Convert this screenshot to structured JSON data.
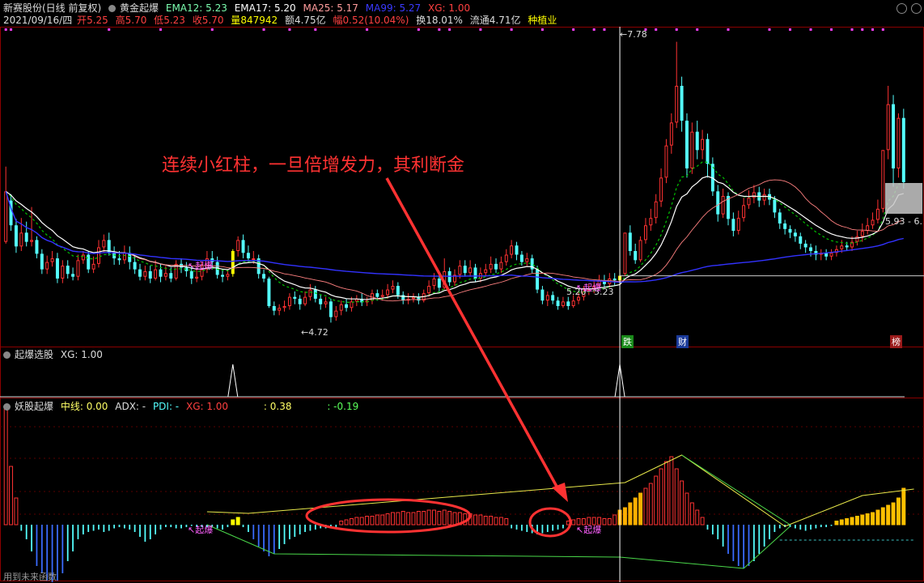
{
  "header": {
    "stock_name": "新赛股份(日线 前复权)",
    "indicator_name": "黄金起爆",
    "ema12": "EMA12: 5.23",
    "ema17": "EMA17: 5.20",
    "ma25": "MA25: 5.17",
    "ma99": "MA99: 5.27",
    "xg": "XG: 1.00"
  },
  "quote": {
    "date": "2021/09/16/四",
    "open_label": "开",
    "open": "5.25",
    "high_label": "高",
    "high": "5.70",
    "low_label": "低",
    "low": "5.23",
    "close_label": "收",
    "close": "5.70",
    "vol_label": "量",
    "vol": "847942",
    "amount": "额4.75亿",
    "change_label": "幅",
    "change": "0.52(10.04%)",
    "turnover": "换18.01%",
    "float": "流通4.71亿",
    "sector": "种植业"
  },
  "price_labels": {
    "peak": "7.78",
    "low": "4.72",
    "mark_left": "5.20",
    "mark_right": "5.23",
    "right": "5.93 - 6.",
    "qibao1": "起爆",
    "qibao2": "起爆",
    "qibao3": "起爆",
    "qibao4": "起爆",
    "event_die": "跌",
    "event_cai": "财",
    "event_bang": "榜"
  },
  "annotation": "连续小红柱，一旦倍增发力，其利断金",
  "panel2": {
    "name": "起爆选股",
    "xg": "XG: 1.00"
  },
  "panel3": {
    "name": "妖股起爆",
    "mid": "中线: 0.00",
    "adx": "ADX: -",
    "pdi": "PDI: -",
    "xg": "XG: 1.00",
    "v1": ": 0.38",
    "v2": ": -0.19"
  },
  "footer": "用到未来函数",
  "colors": {
    "up": "#ff3232",
    "down": "#54ffff",
    "yellow": "#ffff00",
    "ma99": "#3232ff",
    "ema_green": "#00cc00",
    "orange": "#ffb000",
    "blue_bar": "#3a6cff"
  },
  "chart_data": {
    "type": "candlestick",
    "candles": [
      [
        5.6,
        6.15,
        6.42,
        5.58
      ],
      [
        6.05,
        5.78,
        6.12,
        5.72
      ],
      [
        5.78,
        5.55,
        5.85,
        5.48
      ],
      [
        5.55,
        5.7,
        5.86,
        5.5
      ],
      [
        5.7,
        5.6,
        5.82,
        5.55
      ],
      [
        5.6,
        5.62,
        5.98,
        5.55
      ],
      [
        5.62,
        5.47,
        5.66,
        5.42
      ],
      [
        5.47,
        5.3,
        5.52,
        5.25
      ],
      [
        5.3,
        5.38,
        5.45,
        5.25
      ],
      [
        5.38,
        5.42,
        5.5,
        5.33
      ],
      [
        5.42,
        5.2,
        5.48,
        5.15
      ],
      [
        5.2,
        5.34,
        5.4,
        5.15
      ],
      [
        5.34,
        5.25,
        5.4,
        5.2
      ],
      [
        5.25,
        5.22,
        5.32,
        5.18
      ],
      [
        5.22,
        5.4,
        5.46,
        5.18
      ],
      [
        5.4,
        5.46,
        5.5,
        5.36
      ],
      [
        5.46,
        5.3,
        5.5,
        5.26
      ],
      [
        5.3,
        5.36,
        5.44,
        5.26
      ],
      [
        5.36,
        5.54,
        5.62,
        5.32
      ],
      [
        5.54,
        5.62,
        5.68,
        5.48
      ],
      [
        5.62,
        5.48,
        5.7,
        5.45
      ],
      [
        5.48,
        5.42,
        5.55,
        5.35
      ],
      [
        5.42,
        5.4,
        5.5,
        5.35
      ],
      [
        5.4,
        5.48,
        5.56,
        5.36
      ],
      [
        5.48,
        5.38,
        5.55,
        5.3
      ],
      [
        5.38,
        5.3,
        5.45,
        5.25
      ],
      [
        5.3,
        5.22,
        5.36,
        5.18
      ],
      [
        5.22,
        5.28,
        5.34,
        5.18
      ],
      [
        5.28,
        5.2,
        5.34,
        5.15
      ],
      [
        5.2,
        5.3,
        5.4,
        5.18
      ],
      [
        5.3,
        5.22,
        5.36,
        5.16
      ],
      [
        5.22,
        5.26,
        5.34,
        5.18
      ],
      [
        5.26,
        5.2,
        5.32,
        5.16
      ],
      [
        5.2,
        5.36,
        5.4,
        5.18
      ],
      [
        5.36,
        5.32,
        5.42,
        5.26
      ],
      [
        5.32,
        5.28,
        5.38,
        5.22
      ],
      [
        5.28,
        5.2,
        5.34,
        5.14
      ],
      [
        5.2,
        5.22,
        5.3,
        5.16
      ],
      [
        5.22,
        5.3,
        5.38,
        5.18
      ],
      [
        5.3,
        5.42,
        5.5,
        5.26
      ],
      [
        5.42,
        5.38,
        5.5,
        5.3
      ],
      [
        5.38,
        5.24,
        5.44,
        5.2
      ],
      [
        5.24,
        5.22,
        5.3,
        5.16
      ],
      [
        5.22,
        5.25,
        5.3,
        5.18
      ],
      [
        5.25,
        5.5,
        5.52,
        5.22
      ],
      [
        5.5,
        5.62,
        5.66,
        5.44
      ],
      [
        5.62,
        5.48,
        5.68,
        5.42
      ],
      [
        5.48,
        5.42,
        5.56,
        5.38
      ],
      [
        5.42,
        5.42,
        5.5,
        5.36
      ],
      [
        5.42,
        5.25,
        5.46,
        5.2
      ],
      [
        5.25,
        5.2,
        5.3,
        5.16
      ],
      [
        5.2,
        4.9,
        5.22,
        4.88
      ],
      [
        4.9,
        4.85,
        4.95,
        4.8
      ],
      [
        4.85,
        4.88,
        4.92,
        4.8
      ],
      [
        4.88,
        4.9,
        4.96,
        4.84
      ],
      [
        4.9,
        5.0,
        5.04,
        4.86
      ],
      [
        5.0,
        4.98,
        5.06,
        4.92
      ],
      [
        4.98,
        4.92,
        5.02,
        4.86
      ],
      [
        4.92,
        5.0,
        5.06,
        4.9
      ],
      [
        5.0,
        5.08,
        5.14,
        4.96
      ],
      [
        5.08,
        4.98,
        5.12,
        4.94
      ],
      [
        4.98,
        4.92,
        5.02,
        4.86
      ],
      [
        4.92,
        4.95,
        5.0,
        4.88
      ],
      [
        4.95,
        4.78,
        4.98,
        4.72
      ],
      [
        4.78,
        4.85,
        4.9,
        4.74
      ],
      [
        4.85,
        4.92,
        4.96,
        4.8
      ],
      [
        4.92,
        4.88,
        4.98,
        4.84
      ],
      [
        4.88,
        4.95,
        5.0,
        4.84
      ],
      [
        4.95,
        4.98,
        5.02,
        4.9
      ],
      [
        4.98,
        4.94,
        5.04,
        4.9
      ],
      [
        4.94,
        4.96,
        5.0,
        4.9
      ],
      [
        4.96,
        5.04,
        5.08,
        4.92
      ],
      [
        5.04,
        5.0,
        5.08,
        4.96
      ],
      [
        5.0,
        5.02,
        5.08,
        4.96
      ],
      [
        5.02,
        5.08,
        5.14,
        4.98
      ],
      [
        5.08,
        5.12,
        5.18,
        5.04
      ],
      [
        5.12,
        5.02,
        5.16,
        4.98
      ],
      [
        5.02,
        4.96,
        5.06,
        4.92
      ],
      [
        4.96,
        4.98,
        5.04,
        4.92
      ],
      [
        4.98,
        5.0,
        5.04,
        4.94
      ],
      [
        5.0,
        4.96,
        5.04,
        4.92
      ],
      [
        4.96,
        5.04,
        5.08,
        4.94
      ],
      [
        5.04,
        5.12,
        5.18,
        5.0
      ],
      [
        5.12,
        5.2,
        5.26,
        5.08
      ],
      [
        5.2,
        5.1,
        5.24,
        5.06
      ],
      [
        5.1,
        5.28,
        5.42,
        5.08
      ],
      [
        5.28,
        5.16,
        5.32,
        5.12
      ],
      [
        5.16,
        5.24,
        5.3,
        5.12
      ],
      [
        5.24,
        5.34,
        5.4,
        5.2
      ],
      [
        5.34,
        5.26,
        5.4,
        5.22
      ],
      [
        5.26,
        5.32,
        5.4,
        5.22
      ],
      [
        5.32,
        5.2,
        5.36,
        5.16
      ],
      [
        5.2,
        5.26,
        5.32,
        5.16
      ],
      [
        5.26,
        5.3,
        5.36,
        5.22
      ],
      [
        5.3,
        5.36,
        5.44,
        5.26
      ],
      [
        5.36,
        5.3,
        5.42,
        5.26
      ],
      [
        5.3,
        5.38,
        5.44,
        5.26
      ],
      [
        5.38,
        5.46,
        5.52,
        5.34
      ],
      [
        5.46,
        5.56,
        5.62,
        5.42
      ],
      [
        5.56,
        5.46,
        5.6,
        5.4
      ],
      [
        5.46,
        5.38,
        5.5,
        5.34
      ],
      [
        5.38,
        5.42,
        5.48,
        5.34
      ],
      [
        5.42,
        5.3,
        5.46,
        5.26
      ],
      [
        5.3,
        5.08,
        5.34,
        5.04
      ],
      [
        5.08,
        4.96,
        5.12,
        4.92
      ],
      [
        4.96,
        5.02,
        5.06,
        4.9
      ],
      [
        5.02,
        4.96,
        5.06,
        4.92
      ],
      [
        4.96,
        4.9,
        5.0,
        4.86
      ],
      [
        4.9,
        4.95,
        5.0,
        4.88
      ],
      [
        4.95,
        4.9,
        5.0,
        4.86
      ],
      [
        4.9,
        4.96,
        5.02,
        4.88
      ],
      [
        4.96,
        5.0,
        5.06,
        4.92
      ],
      [
        5.0,
        5.06,
        5.12,
        4.96
      ],
      [
        5.06,
        5.08,
        5.14,
        5.02
      ],
      [
        5.08,
        5.12,
        5.18,
        5.04
      ],
      [
        5.12,
        5.18,
        5.24,
        5.08
      ],
      [
        5.18,
        5.14,
        5.24,
        5.1
      ],
      [
        5.14,
        5.2,
        5.26,
        5.1
      ],
      [
        5.2,
        5.18,
        5.26,
        5.12
      ],
      [
        5.18,
        5.23,
        5.3,
        5.14
      ],
      [
        5.25,
        5.7,
        5.7,
        5.23
      ],
      [
        5.7,
        5.5,
        5.78,
        5.45
      ],
      [
        5.5,
        5.4,
        5.58,
        5.36
      ],
      [
        5.4,
        5.62,
        5.66,
        5.38
      ],
      [
        5.62,
        5.78,
        5.86,
        5.58
      ],
      [
        5.78,
        5.86,
        5.96,
        5.72
      ],
      [
        5.86,
        6.04,
        6.12,
        5.8
      ],
      [
        6.04,
        6.3,
        6.4,
        5.98
      ],
      [
        6.3,
        6.65,
        6.72,
        6.24
      ],
      [
        6.65,
        6.9,
        7.0,
        6.56
      ],
      [
        6.9,
        7.3,
        7.78,
        6.84
      ],
      [
        7.3,
        6.92,
        7.4,
        6.8
      ],
      [
        6.92,
        6.4,
        7.0,
        6.3
      ],
      [
        6.4,
        6.8,
        6.9,
        6.34
      ],
      [
        6.8,
        6.6,
        6.92,
        6.5
      ],
      [
        6.6,
        6.72,
        6.82,
        6.5
      ],
      [
        6.72,
        6.45,
        6.78,
        6.3
      ],
      [
        6.45,
        6.15,
        6.52,
        6.1
      ],
      [
        6.15,
        5.9,
        6.22,
        5.82
      ],
      [
        5.9,
        6.1,
        6.18,
        5.86
      ],
      [
        6.1,
        5.85,
        6.14,
        5.78
      ],
      [
        5.85,
        5.72,
        5.92,
        5.66
      ],
      [
        5.72,
        5.86,
        5.94,
        5.68
      ],
      [
        5.86,
        6.0,
        6.08,
        5.82
      ],
      [
        6.0,
        6.08,
        6.16,
        5.96
      ],
      [
        6.08,
        6.14,
        6.22,
        6.02
      ],
      [
        6.14,
        6.05,
        6.2,
        5.98
      ],
      [
        6.05,
        6.12,
        6.18,
        6.0
      ],
      [
        6.12,
        6.06,
        6.18,
        6.0
      ],
      [
        6.06,
        5.92,
        6.1,
        5.86
      ],
      [
        5.92,
        5.8,
        5.96,
        5.74
      ],
      [
        5.8,
        5.74,
        5.84,
        5.68
      ],
      [
        5.74,
        5.7,
        5.78,
        5.64
      ],
      [
        5.7,
        5.66,
        5.74,
        5.6
      ],
      [
        5.66,
        5.58,
        5.7,
        5.52
      ],
      [
        5.58,
        5.54,
        5.62,
        5.48
      ],
      [
        5.54,
        5.5,
        5.58,
        5.44
      ],
      [
        5.5,
        5.46,
        5.56,
        5.4
      ],
      [
        5.46,
        5.48,
        5.52,
        5.4
      ],
      [
        5.48,
        5.44,
        5.52,
        5.4
      ],
      [
        5.44,
        5.48,
        5.52,
        5.4
      ],
      [
        5.48,
        5.52,
        5.56,
        5.44
      ],
      [
        5.52,
        5.56,
        5.62,
        5.48
      ],
      [
        5.56,
        5.54,
        5.6,
        5.5
      ],
      [
        5.54,
        5.6,
        5.66,
        5.5
      ],
      [
        5.6,
        5.66,
        5.72,
        5.56
      ],
      [
        5.66,
        5.72,
        5.8,
        5.6
      ],
      [
        5.72,
        5.78,
        5.86,
        5.68
      ],
      [
        5.78,
        5.84,
        5.92,
        5.74
      ],
      [
        5.84,
        5.96,
        6.06,
        5.8
      ],
      [
        5.96,
        6.6,
        6.6,
        5.92
      ],
      [
        6.6,
        7.1,
        7.3,
        6.5
      ],
      [
        7.1,
        6.4,
        7.2,
        6.2
      ],
      [
        6.4,
        6.95,
        7.0,
        6.3
      ],
      [
        6.95,
        6.25,
        7.05,
        6.18
      ]
    ],
    "ylim": [
      4.6,
      7.9
    ],
    "lines": [
      "EMA12",
      "EMA17",
      "MA25",
      "MA99"
    ],
    "xg_signals": [
      44,
      119
    ],
    "panel3_bars": [
      0.95,
      0.48,
      0.22,
      -0.05,
      -0.12,
      -0.22,
      -0.34,
      -0.4,
      -0.46,
      -0.48,
      -0.46,
      -0.4,
      -0.3,
      -0.22,
      -0.12,
      -0.08,
      -0.06,
      -0.05,
      -0.04,
      -0.06,
      -0.05,
      -0.03,
      -0.02,
      -0.03,
      -0.04,
      -0.06,
      -0.1,
      -0.14,
      -0.12,
      -0.08,
      -0.04,
      -0.02,
      -0.02,
      -0.03,
      -0.03,
      -0.02,
      -0.01,
      -0.02,
      -0.02,
      -0.02,
      -0.02,
      -0.03,
      -0.04,
      -0.02,
      0.04,
      0.06,
      -0.02,
      -0.06,
      -0.12,
      -0.18,
      -0.22,
      -0.26,
      -0.24,
      -0.2,
      -0.16,
      -0.12,
      -0.1,
      -0.08,
      -0.06,
      -0.05,
      -0.04,
      -0.03,
      -0.03,
      -0.02,
      -0.02,
      0.03,
      0.04,
      0.05,
      0.06,
      0.06,
      0.07,
      0.07,
      0.08,
      0.08,
      0.09,
      0.1,
      0.1,
      0.11,
      0.1,
      0.1,
      0.11,
      0.11,
      0.12,
      0.12,
      0.11,
      0.12,
      0.11,
      0.1,
      0.1,
      0.09,
      0.09,
      0.08,
      0.08,
      0.07,
      0.07,
      0.06,
      0.06,
      0.05,
      -0.03,
      -0.04,
      -0.05,
      -0.06,
      -0.07,
      -0.08,
      -0.07,
      -0.06,
      -0.05,
      -0.04,
      -0.03,
      0.03,
      0.04,
      0.05,
      0.05,
      0.06,
      0.06,
      0.06,
      0.05,
      0.05,
      0.08,
      0.12,
      0.14,
      0.18,
      0.22,
      0.26,
      0.3,
      0.34,
      0.4,
      0.46,
      0.52,
      0.56,
      0.46,
      0.36,
      0.26,
      0.18,
      0.12,
      0.06,
      -0.04,
      -0.08,
      -0.12,
      -0.18,
      -0.24,
      -0.3,
      -0.34,
      -0.36,
      -0.34,
      -0.3,
      -0.24,
      -0.18,
      -0.12,
      -0.06,
      -0.03,
      -0.02,
      -0.02,
      -0.03,
      -0.04,
      -0.05,
      -0.04,
      -0.03,
      -0.02,
      -0.02,
      -0.01,
      0.03,
      0.04,
      0.05,
      0.06,
      0.07,
      0.08,
      0.09,
      0.1,
      0.12,
      0.14,
      0.16,
      0.18,
      0.22,
      0.3,
      0.32,
      0.38
    ]
  }
}
